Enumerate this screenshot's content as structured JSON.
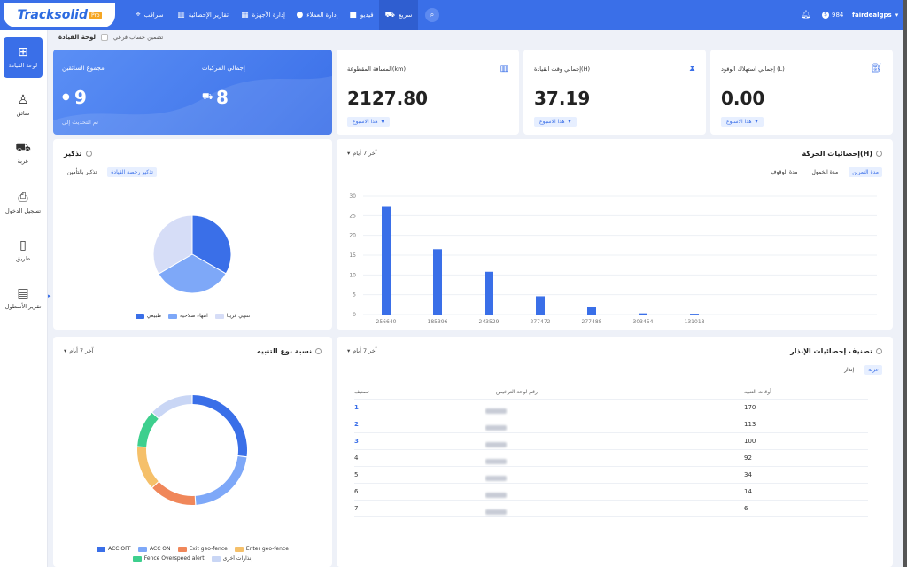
{
  "topbar": {
    "logo_text": "Tracksolid",
    "logo_badge": "Pro",
    "nav": [
      {
        "label": "سراقب",
        "icon": "location-pin-icon"
      },
      {
        "label": "تقارير الإحصائية",
        "icon": "bar-chart-icon"
      },
      {
        "label": "إدارة الأجهزة",
        "icon": "device-icon"
      },
      {
        "label": "إدارة العملاء",
        "icon": "user-icon"
      },
      {
        "label": "فيديو",
        "icon": "video-camera-icon"
      },
      {
        "label": "سريع",
        "icon": "car-icon"
      }
    ],
    "balance": "984",
    "username": "fairdealgps"
  },
  "sidebar": {
    "items": [
      {
        "label": "لوحة القيادة",
        "icon": "grid-icon"
      },
      {
        "label": "سائق",
        "icon": "driver-icon"
      },
      {
        "label": "عربة",
        "icon": "vehicle-icon"
      },
      {
        "label": "تسجيل الدخول",
        "icon": "login-icon"
      },
      {
        "label": "طريق",
        "icon": "road-icon"
      },
      {
        "label": "تقرير الأسطول",
        "icon": "fleet-report-icon"
      }
    ]
  },
  "breadcrumb": {
    "title": "لوحة القيادة",
    "sub_account": "تضمين حساب فرعي"
  },
  "summary": {
    "drivers_label": "مجموع السائقين",
    "drivers_value": "9",
    "vehicles_label": "إجمالي المركبات",
    "vehicles_value": "8",
    "updated": "تم التحديث إلى"
  },
  "stats": [
    {
      "label": "المسافة المقطوعة(km)",
      "value": "2127.80",
      "period": "هذا الاسبوع",
      "icon": "bar-chart-icon"
    },
    {
      "label": "إجمالي وقت القيادة(H)",
      "value": "37.19",
      "period": "هذا الاسبوع",
      "icon": "hourglass-icon"
    },
    {
      "label": "إجمالي استهلاك الوقود (L)",
      "value": "0.00",
      "period": "هذا الاسبوع",
      "icon": "fuel-icon"
    }
  ],
  "reminder": {
    "title": "تذكير",
    "tabs": [
      "تذكير بالتأمين",
      "تذكير رخصة القيادة"
    ],
    "legend": [
      "طبيعي",
      "انتهاء صلاحية",
      "تنتهي قريبا"
    ],
    "colors": [
      "#3a6fe8",
      "#7ea8f8",
      "#d6ddf7"
    ]
  },
  "movement": {
    "title": "إحصائيات الحركة(H)",
    "period": "آخر 7 أيام",
    "tabs": [
      "مدة التمرين",
      "مدة الخمول",
      "مدة الوقوف"
    ]
  },
  "alert_ratio": {
    "title": "نسبة نوع التنبيه",
    "period": "آخر 7 أيام",
    "legend": [
      {
        "name": "ACC OFF",
        "color": "#3a6fe8"
      },
      {
        "name": "ACC ON",
        "color": "#7ea8f8"
      },
      {
        "name": "Exit geo-fence",
        "color": "#f0875a"
      },
      {
        "name": "Enter geo-fence",
        "color": "#f5c06a"
      },
      {
        "name": "Fence Overspeed alert",
        "color": "#3ecf8e"
      },
      {
        "name": "إنذارات أخرى",
        "color": "#c9d6f5"
      }
    ]
  },
  "alarm_ranking": {
    "title": "تصنيف إحصائيات الإنذار",
    "period": "آخر 7 أيام",
    "tabs": [
      "عربة",
      "إنذار"
    ],
    "columns": [
      "تصنيف",
      "رقم لوحة الترخيص",
      "أوقات التنبيه"
    ],
    "rows": [
      {
        "rank": "1",
        "count": "170"
      },
      {
        "rank": "2",
        "count": "113"
      },
      {
        "rank": "3",
        "count": "100"
      },
      {
        "rank": "4",
        "count": "92"
      },
      {
        "rank": "5",
        "count": "34"
      },
      {
        "rank": "6",
        "count": "14"
      },
      {
        "rank": "7",
        "count": "6"
      }
    ]
  },
  "chart_data": [
    {
      "type": "bar",
      "categories": [
        "256640",
        "185396",
        "243529",
        "277472",
        "277488",
        "303454",
        "131018"
      ],
      "values": [
        27.2,
        16.5,
        10.8,
        4.6,
        2.0,
        0.3,
        0.2
      ],
      "ylim": [
        0,
        30
      ],
      "yticks": [
        0,
        5,
        10,
        15,
        20,
        25,
        30
      ],
      "grid": true
    },
    {
      "type": "pie",
      "categories": [
        "طبيعي",
        "انتهاء صلاحية",
        "تنتهي قريبا"
      ],
      "values": [
        33.3,
        33.3,
        33.4
      ]
    },
    {
      "type": "pie",
      "categories": [
        "ACC OFF",
        "ACC ON",
        "Exit geo-fence",
        "Enter geo-fence",
        "Fence Overspeed alert",
        "إنذارات أخرى"
      ],
      "values": [
        27,
        22,
        14,
        13,
        11,
        13
      ]
    }
  ]
}
